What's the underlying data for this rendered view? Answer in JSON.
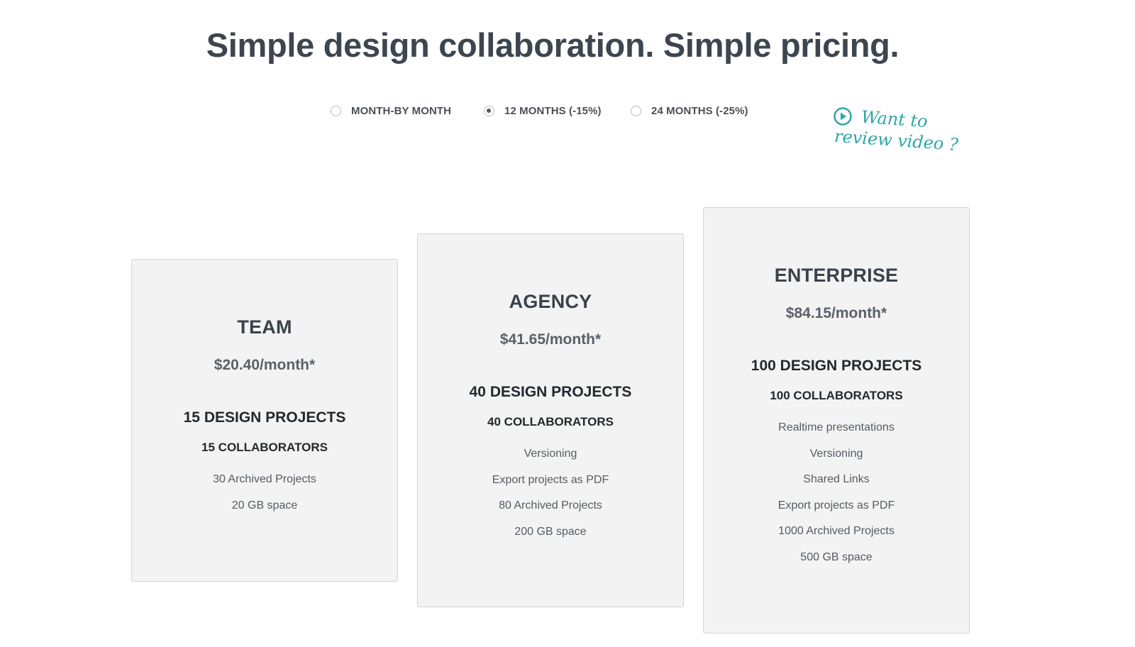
{
  "page": {
    "headline": "Simple design collaboration. Simple pricing."
  },
  "billing": {
    "options": [
      {
        "label": "MONTH-BY MONTH",
        "selected": false
      },
      {
        "label": "12 MONTHS (-15%)",
        "selected": true
      },
      {
        "label": "24 MONTHS (-25%)",
        "selected": false
      }
    ]
  },
  "video_cta": {
    "line1": "Want to",
    "line2": "review video ?",
    "icon": "play-circle-icon",
    "color": "#2fa5a9"
  },
  "plans": [
    {
      "name": "TEAM",
      "price": "$20.40/month*",
      "projects": "15 DESIGN PROJECTS",
      "collaborators": "15 COLLABORATORS",
      "features": [
        "30 Archived Projects",
        "20 GB space"
      ]
    },
    {
      "name": "AGENCY",
      "price": "$41.65/month*",
      "projects": "40 DESIGN PROJECTS",
      "collaborators": "40 COLLABORATORS",
      "features": [
        "Versioning",
        "Export projects as PDF",
        "80 Archived Projects",
        "200 GB space"
      ]
    },
    {
      "name": "ENTERPRISE",
      "price": "$84.15/month*",
      "projects": "100 DESIGN PROJECTS",
      "collaborators": "100 COLLABORATORS",
      "features": [
        "Realtime presentations",
        "Versioning",
        "Shared Links",
        "Export projects as PDF",
        "1000 Archived Projects",
        "500 GB space"
      ]
    }
  ],
  "colors": {
    "heading": "#3d4650",
    "card_background": "#f3f3f3",
    "card_border": "#d2d4d6",
    "accent": "#2fa5a9"
  }
}
